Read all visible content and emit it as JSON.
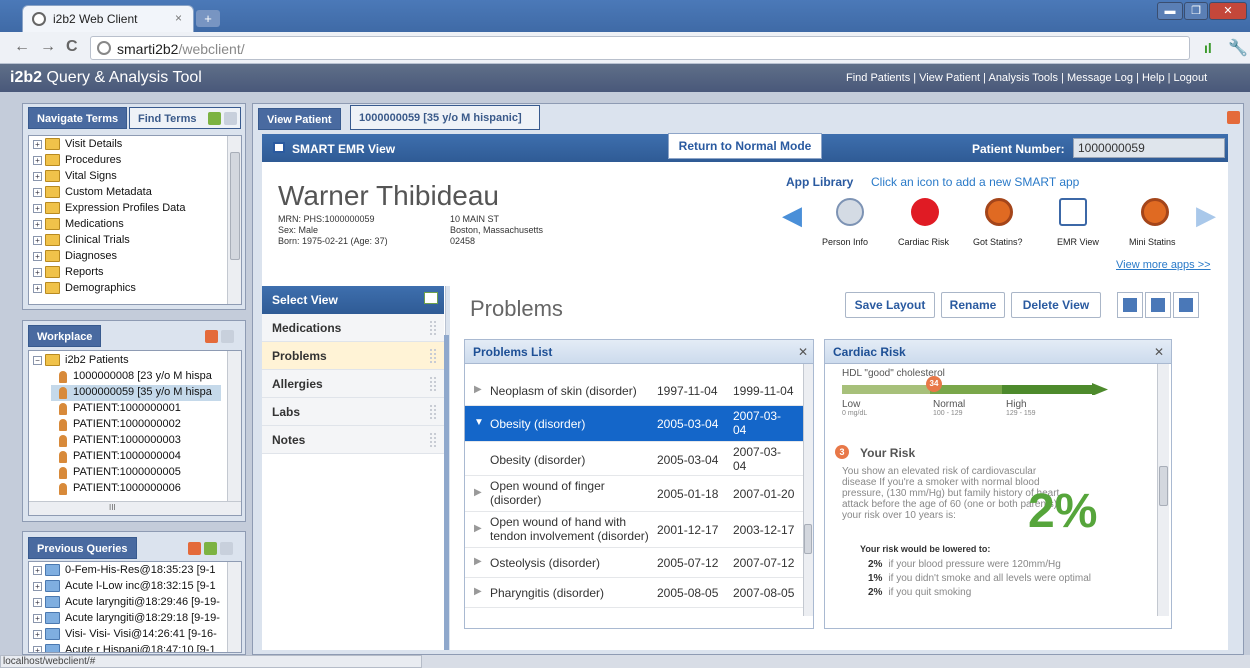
{
  "browser": {
    "tab_title": "i2b2 Web Client",
    "tab_close": "×",
    "new_tab": "+",
    "url_host": "smarti2b2",
    "url_path": "/webclient/"
  },
  "app": {
    "title_bold": "i2b2",
    "title_rest": " Query & Analysis Tool",
    "links": "Find Patients | View Patient | Analysis Tools | Message Log | Help | Logout"
  },
  "navigate": {
    "tab_navigate": "Navigate Terms",
    "tab_find": "Find Terms",
    "items": [
      "Visit Details",
      "Procedures",
      "Vital Signs",
      "Custom Metadata",
      "Expression Profiles Data",
      "Medications",
      "Clinical Trials",
      "Diagnoses",
      "Reports",
      "Demographics"
    ]
  },
  "workplace": {
    "tab": "Workplace",
    "root": "i2b2 Patients",
    "items": [
      "1000000008 [23 y/o M hispa",
      "1000000059 [35 y/o M hispa",
      "PATIENT:1000000001",
      "PATIENT:1000000002",
      "PATIENT:1000000003",
      "PATIENT:1000000004",
      "PATIENT:1000000005",
      "PATIENT:1000000006"
    ],
    "hscroll": "III"
  },
  "previous": {
    "tab": "Previous Queries",
    "items": [
      "0-Fem-His-Res@18:35:23 [9-1",
      "Acute l-Low inc@18:32:15 [9-1",
      "Acute laryngiti@18:29:46 [9-19-",
      "Acute laryngiti@18:29:18 [9-19-",
      "Visi- Visi- Visi@14:26:41 [9-16-",
      "Acute r Hispani@18:47:10 [9-1"
    ]
  },
  "main": {
    "tab_view": "View Patient",
    "tab_patient": "1000000059 [35 y/o M hispanic]",
    "emr_title": "SMART EMR View",
    "return_btn": "Return to Normal Mode",
    "patient_number_label": "Patient Number:",
    "patient_number": "1000000059"
  },
  "patient": {
    "name": "Warner Thibideau",
    "mrn": "MRN: PHS:1000000059",
    "sex": "Sex: Male",
    "born": "Born: 1975-02-21 (Age: 37)",
    "addr1": "10 MAIN ST",
    "addr2": "Boston, Massachusetts",
    "zip": "02458"
  },
  "applib": {
    "title": "App Library",
    "hint": "Click an icon to add a new SMART app",
    "apps": [
      "Person Info",
      "Cardiac Risk",
      "Got Statins?",
      "EMR View",
      "Mini Statins"
    ],
    "view_more": "View more apps >>"
  },
  "selectview": {
    "title": "Select View",
    "items": [
      "Medications",
      "Problems",
      "Allergies",
      "Labs",
      "Notes"
    ],
    "active": "Problems"
  },
  "problems": {
    "title": "Problems",
    "buttons": {
      "save": "Save Layout",
      "rename": "Rename",
      "delete": "Delete View"
    },
    "list_title": "Problems List",
    "rows": [
      {
        "name": "Neoplasm of skin (disorder)",
        "start": "1997-11-04",
        "end": "1999-11-04",
        "tri": "▶"
      },
      {
        "name": "Obesity (disorder)",
        "start": "2005-03-04",
        "end": "2007-03-04",
        "tri": "▼"
      },
      {
        "name": "Obesity (disorder)",
        "start": "2005-03-04",
        "end": "2007-03-04",
        "tri": ""
      },
      {
        "name": "Open wound of finger (disorder)",
        "start": "2005-01-18",
        "end": "2007-01-20",
        "tri": "▶"
      },
      {
        "name": "Open wound of hand with tendon involvement (disorder)",
        "start": "2001-12-17",
        "end": "2003-12-17",
        "tri": "▶"
      },
      {
        "name": "Osteolysis (disorder)",
        "start": "2005-07-12",
        "end": "2007-07-12",
        "tri": "▶"
      },
      {
        "name": "Pharyngitis (disorder)",
        "start": "2005-08-05",
        "end": "2007-08-05",
        "tri": "▶"
      }
    ]
  },
  "cardiac": {
    "title": "Cardiac Risk",
    "hdl_label": "HDL \"good\" cholesterol",
    "hdl_value": "34",
    "low": "Low",
    "low_sub": "0 mg/dL",
    "normal": "Normal",
    "normal_sub": "100 - 129",
    "high": "High",
    "high_sub": "129 - 159",
    "step": "3",
    "risk_title": "Your Risk",
    "risk_desc": "You show an elevated risk of cardiovascular disease If you're a smoker with normal blood pressure, (130 mm/Hg) but family history of heart attack before the age of 60 (one or both parents) your risk over 10 years is:",
    "risk_pct": "2%",
    "lower_title": "Your risk would be lowered to:",
    "lower": [
      {
        "pct": "2%",
        "text": "if your blood pressure were 120mm/Hg"
      },
      {
        "pct": "1%",
        "text": "if you didn't smoke and all levels were optimal"
      },
      {
        "pct": "2%",
        "text": "if you quit smoking"
      }
    ]
  },
  "status": "localhost/webclient/#",
  "colors": {
    "accent": "#2f5b95",
    "selected": "#1466c9",
    "risk_green": "#56a53b"
  }
}
